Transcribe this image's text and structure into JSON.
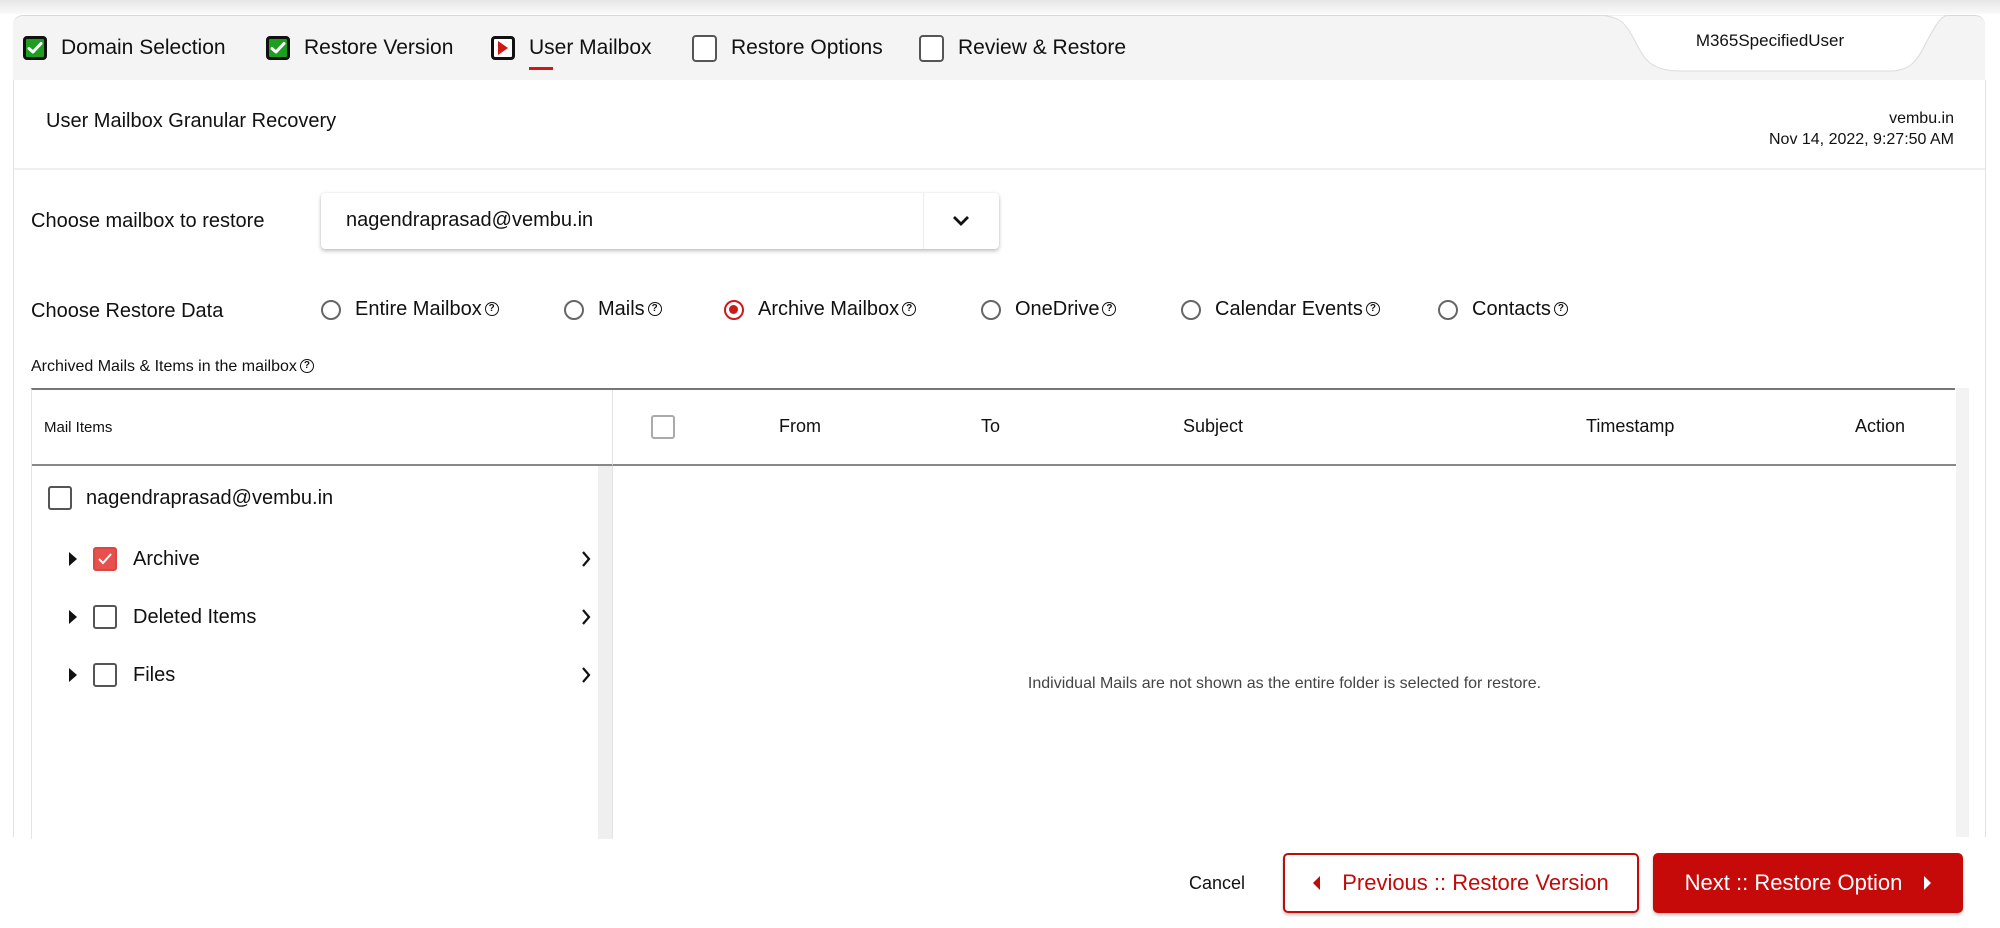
{
  "steps": [
    {
      "label": "Domain Selection",
      "state": "done"
    },
    {
      "label": "Restore Version",
      "state": "done"
    },
    {
      "label": "User Mailbox",
      "state": "current"
    },
    {
      "label": "Restore Options",
      "state": "pending"
    },
    {
      "label": "Review & Restore",
      "state": "pending"
    }
  ],
  "user_tab": "M365SpecifiedUser",
  "header": {
    "title": "User Mailbox Granular Recovery",
    "domain": "vembu.in",
    "timestamp": "Nov 14, 2022, 9:27:50 AM"
  },
  "mailbox": {
    "label": "Choose mailbox to restore",
    "selected": "nagendraprasad@vembu.in"
  },
  "restore_data": {
    "label": "Choose Restore Data",
    "options": [
      {
        "label": "Entire Mailbox",
        "selected": false
      },
      {
        "label": "Mails",
        "selected": false
      },
      {
        "label": "Archive Mailbox",
        "selected": true
      },
      {
        "label": "OneDrive",
        "selected": false
      },
      {
        "label": "Calendar Events",
        "selected": false
      },
      {
        "label": "Contacts",
        "selected": false
      }
    ],
    "help_glyph": "?"
  },
  "archived_label": "Archived Mails & Items in the mailbox",
  "tree": {
    "header": "Mail Items",
    "root": {
      "label": "nagendraprasad@vembu.in",
      "checked": false
    },
    "children": [
      {
        "label": "Archive",
        "checked": true
      },
      {
        "label": "Deleted Items",
        "checked": false
      },
      {
        "label": "Files",
        "checked": false
      }
    ]
  },
  "mail_table": {
    "columns": [
      "From",
      "To",
      "Subject",
      "Timestamp",
      "Action"
    ],
    "empty_message": "Individual Mails are not shown as the entire folder is selected for restore."
  },
  "footer": {
    "cancel": "Cancel",
    "previous": "Previous :: Restore Version",
    "next": "Next :: Restore Option"
  },
  "colors": {
    "accent": "#c60a0a",
    "done": "#1e9e1e",
    "checked": "#e8504d"
  }
}
